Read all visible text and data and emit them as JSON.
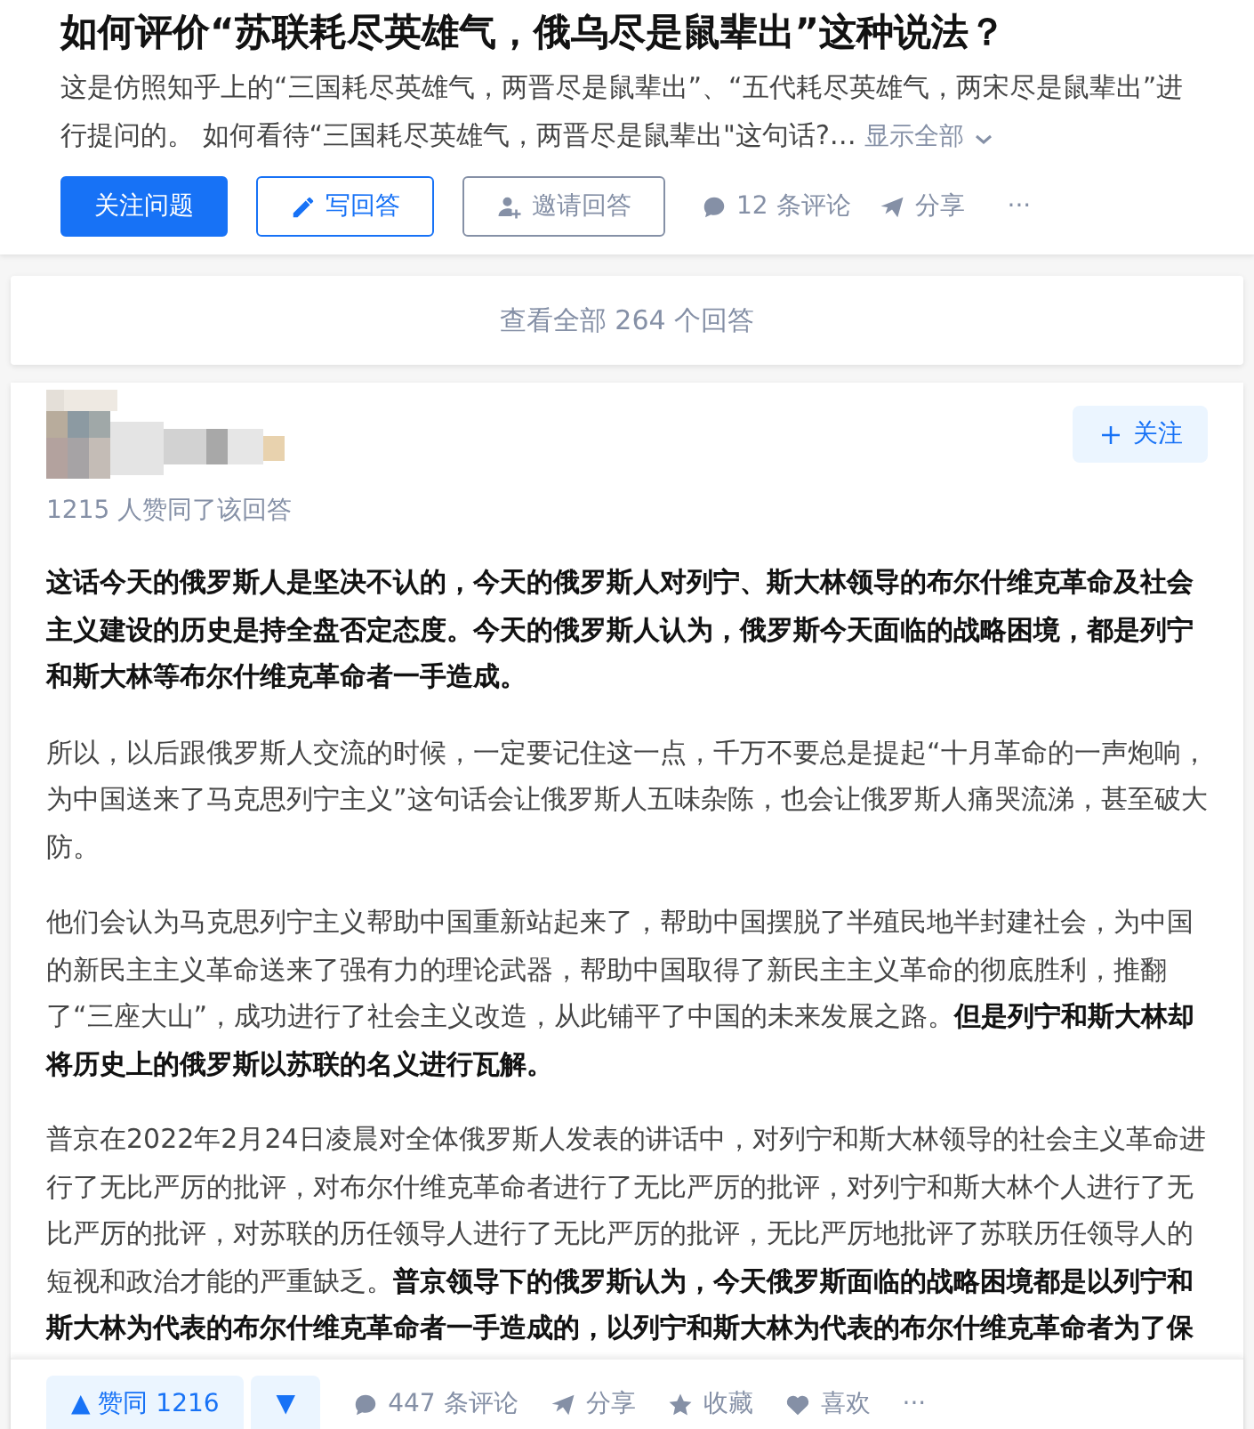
{
  "question": {
    "title": "如何评价“苏联耗尽英雄气，俄乌尽是鼠辈出”这种说法？",
    "excerpt": "这是仿照知乎上的“三国耗尽英雄气，两晋尽是鼠辈出”、“五代耗尽英雄气，两宋尽是鼠辈出”进行提问的。 如何看待“三国耗尽英雄气，两晋尽是鼠辈出\"这句话?…",
    "show_all": "显示全部",
    "actions": {
      "follow": "关注问题",
      "write": "写回答",
      "invite": "邀请回答",
      "comments": "12 条评论",
      "share": "分享",
      "more": "···"
    }
  },
  "view_all": "查看全部 264 个回答",
  "answer": {
    "follow": "关注",
    "upvote_note": "1215 人赞同了该回答",
    "paragraphs": [
      {
        "kind": "bold",
        "text": "这话今天的俄罗斯人是坚决不认的，今天的俄罗斯人对列宁、斯大林领导的布尔什维克革命及社会主义建设的历史是持全盘否定态度。今天的俄罗斯人认为，俄罗斯今天面临的战略困境，都是列宁和斯大林等布尔什维克革命者一手造成。"
      },
      {
        "kind": "plain",
        "text": "所以，以后跟俄罗斯人交流的时候，一定要记住这一点，千万不要总是提起“十月革命的一声炮响，为中国送来了马克思列宁主义”这句话会让俄罗斯人五味杂陈，也会让俄罗斯人痛哭流涕，甚至破大防。"
      },
      {
        "kind": "plain",
        "text": "他们会认为马克思列宁主义帮助中国重新站起来了，帮助中国摆脱了半殖民地半封建社会，为中国的新民主主义革命送来了强有力的理论武器，帮助中国取得了新民主主义革命的彻底胜利，推翻了“三座大山”，成功进行了社会主义改造，从此铺平了中国的未来发展之路。**但是列宁和斯大林却将历史上的俄罗斯以苏联的名义进行瓦解。**"
      },
      {
        "kind": "plain",
        "text": "普京在2022年2月24日凌晨对全体俄罗斯人发表的讲话中，对列宁和斯大林领导的社会主义革命进行了无比严厉的批评，对布尔什维克革命者进行了无比严厉的批评，对列宁和斯大林个人进行了无比严厉的批评，对苏联的历任领导人进行了无比严厉的批评，无比严厉地批评了苏联历任领导人的短视和政治才能的严重缺乏。**普京领导下的俄罗斯认为，今天俄罗斯面临的战略困境都是以列宁和斯大林为代表的布尔什维克革命者一手造成的，以列宁和斯大林为代表的布尔什维克革命者为了保**"
      }
    ],
    "bar": {
      "up_arrow": "▲",
      "upvote": "赞同 1216",
      "downvote": "▼",
      "comments": "447 条评论",
      "share": "分享",
      "favorite": "收藏",
      "like": "喜欢",
      "more": "···"
    }
  }
}
